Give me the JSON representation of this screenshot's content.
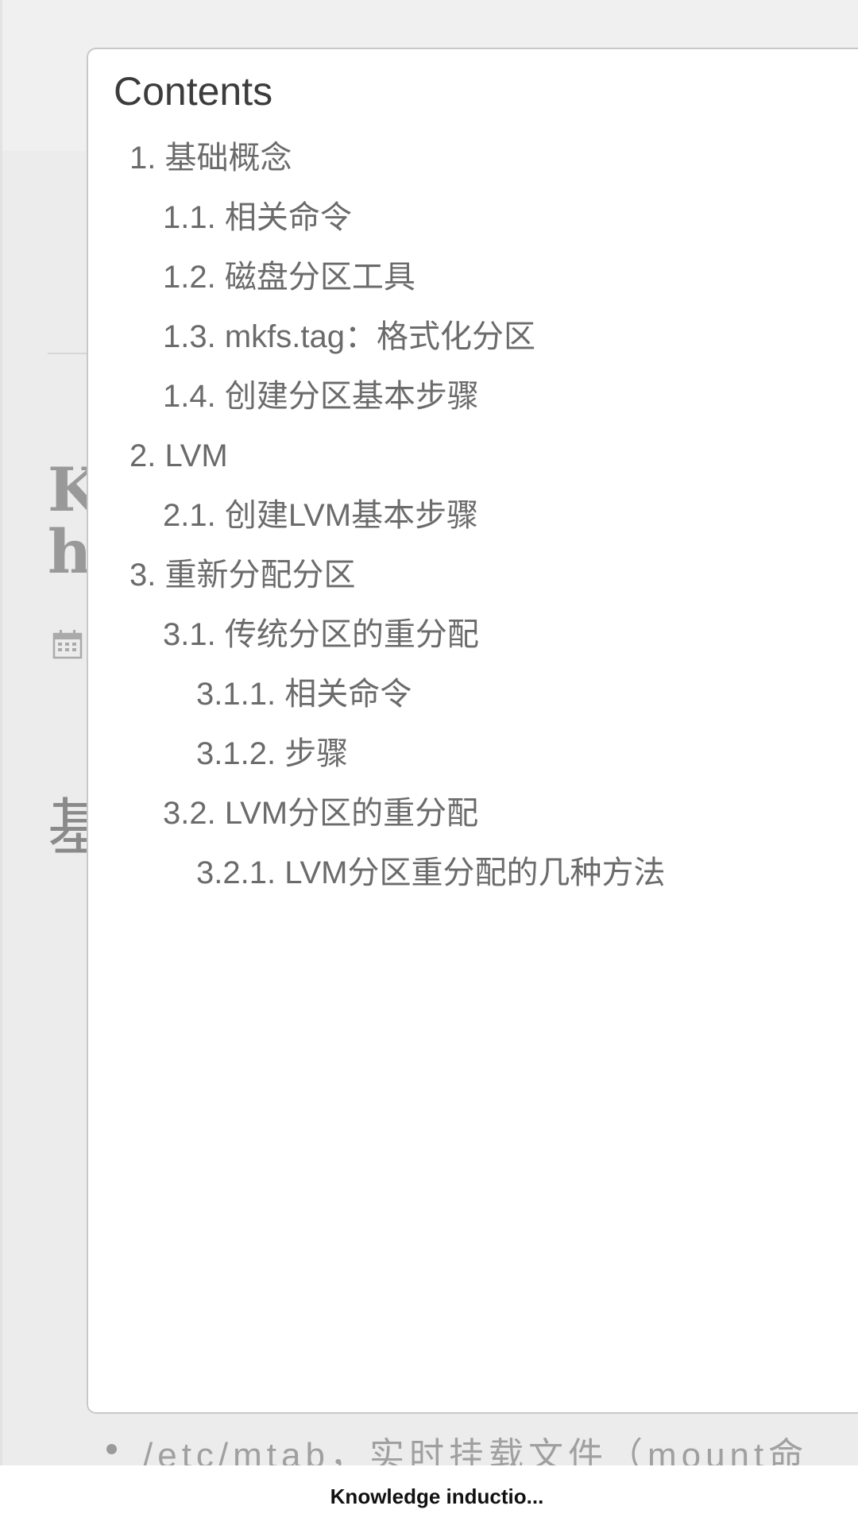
{
  "background": {
    "title_lines": [
      "K",
      "h"
    ],
    "heading": "基",
    "bullet_text": "/etc/mtab，实时挂载文件（mount命"
  },
  "toc": {
    "title": "Contents",
    "items": [
      {
        "label": "1. 基础概念",
        "level": 1
      },
      {
        "label": "1.1. 相关命令",
        "level": 2
      },
      {
        "label": "1.2. 磁盘分区工具",
        "level": 2
      },
      {
        "label": "1.3. mkfs.tag：格式化分区",
        "level": 2
      },
      {
        "label": "1.4. 创建分区基本步骤",
        "level": 2
      },
      {
        "label": "2. LVM",
        "level": 1
      },
      {
        "label": "2.1. 创建LVM基本步骤",
        "level": 2
      },
      {
        "label": "3. 重新分配分区",
        "level": 1
      },
      {
        "label": "3.1. 传统分区的重分配",
        "level": 2
      },
      {
        "label": "3.1.1. 相关命令",
        "level": 3
      },
      {
        "label": "3.1.2. 步骤",
        "level": 3
      },
      {
        "label": "3.2. LVM分区的重分配",
        "level": 2
      },
      {
        "label": "3.2.1. LVM分区重分配的几种方法",
        "level": 3
      }
    ]
  },
  "status_bar": {
    "title": "Knowledge inductio..."
  },
  "icons": {
    "meta": "calendar-icon",
    "bullet": "bullet-dot-icon"
  }
}
